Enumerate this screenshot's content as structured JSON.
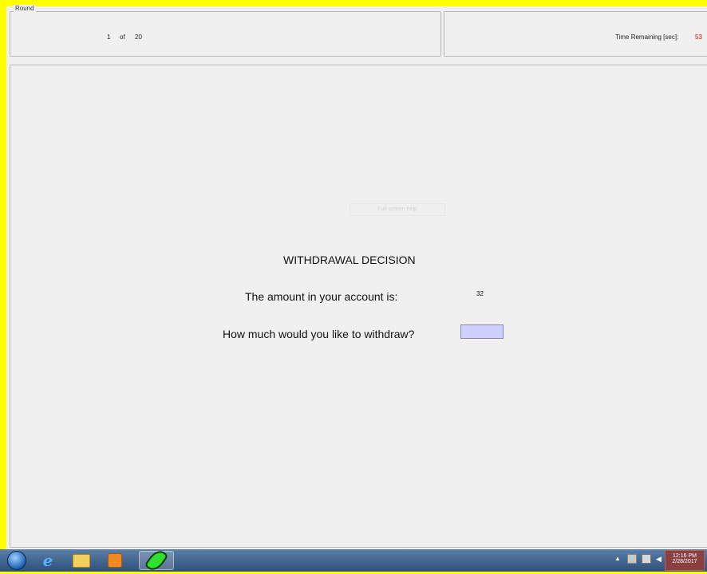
{
  "round_panel": {
    "legend": "Round",
    "current": "1",
    "of": "of",
    "total": "20"
  },
  "time_panel": {
    "label": "Time Remaining [sec]:",
    "value": "53",
    "value_color": "#e00000"
  },
  "main": {
    "fullscreen_help": "Full-screen help",
    "title": "WITHDRAWAL DECISION",
    "amount_label": "The amount in your account is:",
    "amount_value": "32",
    "withdraw_label": "How much would you like to withdraw?",
    "withdraw_input_value": ""
  },
  "taskbar": {
    "icons": [
      "windows-start-icon",
      "internet-explorer-icon",
      "file-explorer-icon",
      "media-player-icon",
      "leaf-app-icon"
    ],
    "tray_icons": [
      "show-hidden-icons",
      "action-center-flag-icon",
      "network-icon",
      "volume-icon"
    ],
    "clock_time": "12:16 PM",
    "clock_date": "2/28/2017"
  },
  "colors": {
    "window_border": "#ffff00",
    "input_bg": "#cfd0ff",
    "panel_bg": "#f0f0f0"
  }
}
